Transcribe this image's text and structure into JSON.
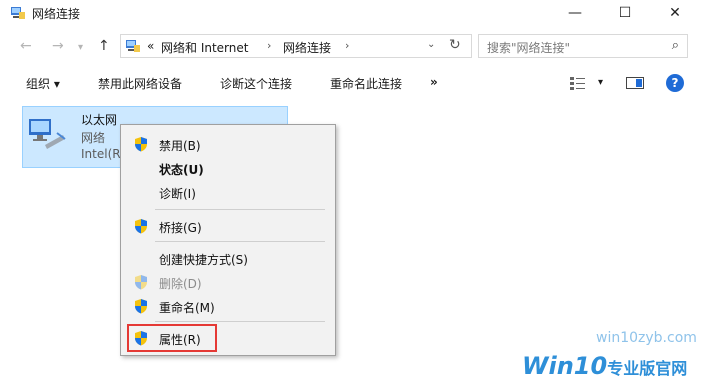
{
  "window": {
    "title": "网络连接",
    "controls": {
      "minimize": "—",
      "maximize": "☐",
      "close": "✕"
    }
  },
  "address": {
    "nav_back": "←",
    "nav_forward": "→",
    "nav_dropdown": "▾",
    "nav_up": "↑",
    "overflow": "«",
    "crumbs": [
      "网络和 Internet",
      "网络连接"
    ],
    "chevron": "›",
    "dropdown": "⌄",
    "refresh": "↻"
  },
  "search": {
    "placeholder": "搜索\"网络连接\"",
    "icon": "⌕"
  },
  "toolbar": {
    "organize": "组织 ▾",
    "disable": "禁用此网络设备",
    "diagnose": "诊断这个连接",
    "rename": "重命名此连接",
    "more": "»",
    "view_dd": "▾",
    "help": "?"
  },
  "adapter": {
    "name": "以太网",
    "status": "网络",
    "device": "Intel(R"
  },
  "context_menu": {
    "items": [
      {
        "label": "禁用(B)"
      },
      {
        "label": "状态(U)"
      },
      {
        "label": "诊断(I)"
      },
      {
        "label": "桥接(G)"
      },
      {
        "label": "创建快捷方式(S)"
      },
      {
        "label": "删除(D)"
      },
      {
        "label": "重命名(M)"
      },
      {
        "label": "属性(R)"
      }
    ]
  },
  "watermark": {
    "line1": "win10zyb.com",
    "brand": "Win10",
    "brand_cn": "专业版官网"
  },
  "colors": {
    "accent": "#1f6bd6",
    "selection": "#cce8ff",
    "highlight_box": "#e53935"
  }
}
